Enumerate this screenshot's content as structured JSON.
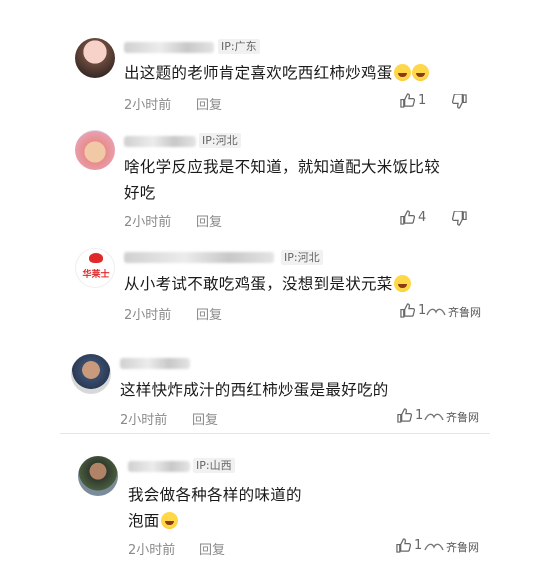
{
  "comments": [
    {
      "ip": "IP:广东",
      "text": "出这题的老师肯定喜欢吃西红柿炒鸡蛋",
      "time": "2小时前",
      "reply": "回复",
      "likes": "1",
      "emoji": "laugh-cry-emoji"
    },
    {
      "ip": "IP:河北",
      "text_line1": "啥化学反应我是不知道，就知道配大米饭比较",
      "text_line2": "好吃",
      "time": "2小时前",
      "reply": "回复",
      "likes": "4"
    },
    {
      "ip": "IP:河北",
      "text": "从小考试不敢吃鸡蛋，没想到是状元菜",
      "time": "2小时前",
      "reply": "回复",
      "likes": "1",
      "emoji": "laugh-cry-emoji",
      "avatar_text": "华莱士"
    },
    {
      "text": "这样快炸成汁的西红柿炒蛋是最好吃的",
      "time": "2小时前",
      "reply": "回复",
      "likes": "1"
    },
    {
      "ip": "IP:山西",
      "text_line1": "我会做各种各样的味道的",
      "text_line2": "泡面",
      "time": "2小时前",
      "reply": "回复",
      "likes": "1",
      "emoji": "laugh-cry-emoji"
    }
  ],
  "watermark": "齐鲁网",
  "colors": {
    "accent_red": "#e02a2a",
    "meta_gray": "#8a8a8a"
  }
}
